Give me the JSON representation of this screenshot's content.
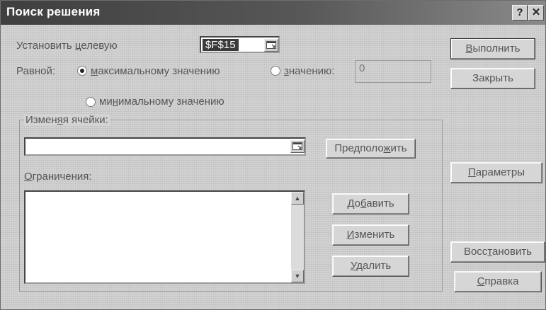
{
  "window": {
    "title": "Поиск решения",
    "help_icon_label": "?",
    "close_icon_label": "✕"
  },
  "target": {
    "label_prefix": "Установить ",
    "label_accel": "ц",
    "label_suffix": "елевую",
    "cell_value": "$F$15"
  },
  "equal": {
    "label": "Равной:",
    "option_max": {
      "accel": "м",
      "rest": "аксимальному значению",
      "selected": true
    },
    "option_value": {
      "accel": "з",
      "rest": "начению:",
      "selected": false
    },
    "value": "0",
    "option_min": {
      "prefix": "ми",
      "accel": "н",
      "rest": "имальному значению",
      "selected": false
    }
  },
  "changing_cells": {
    "label_prefix": "Измен",
    "label_accel": "я",
    "label_suffix": "я ячейки:",
    "value": "",
    "guess_button": {
      "prefix": "Предполо",
      "accel": "ж",
      "suffix": "ить"
    }
  },
  "constraints": {
    "label_accel": "О",
    "label_rest": "граничения:",
    "items": [],
    "add_button": {
      "prefix": "До",
      "accel": "б",
      "suffix": "авить"
    },
    "change_button": {
      "prefix": "",
      "accel": "И",
      "suffix": "зменить"
    },
    "delete_button": {
      "prefix": "",
      "accel": "У",
      "suffix": "далить"
    }
  },
  "side_buttons": {
    "run": {
      "prefix": "",
      "accel": "В",
      "suffix": "ыполнить"
    },
    "close": {
      "label": "Закрыть"
    },
    "params": {
      "prefix": "",
      "accel": "П",
      "suffix": "араметры"
    },
    "reset": {
      "prefix": "Восс",
      "accel": "т",
      "suffix": "ановить"
    },
    "help": {
      "prefix": "",
      "accel": "С",
      "suffix": "правка"
    }
  },
  "colors": {
    "titlebar": "#3f3f3f",
    "dialog_bg": "#d3d3d3",
    "selection_bg": "#3a3a3a"
  }
}
